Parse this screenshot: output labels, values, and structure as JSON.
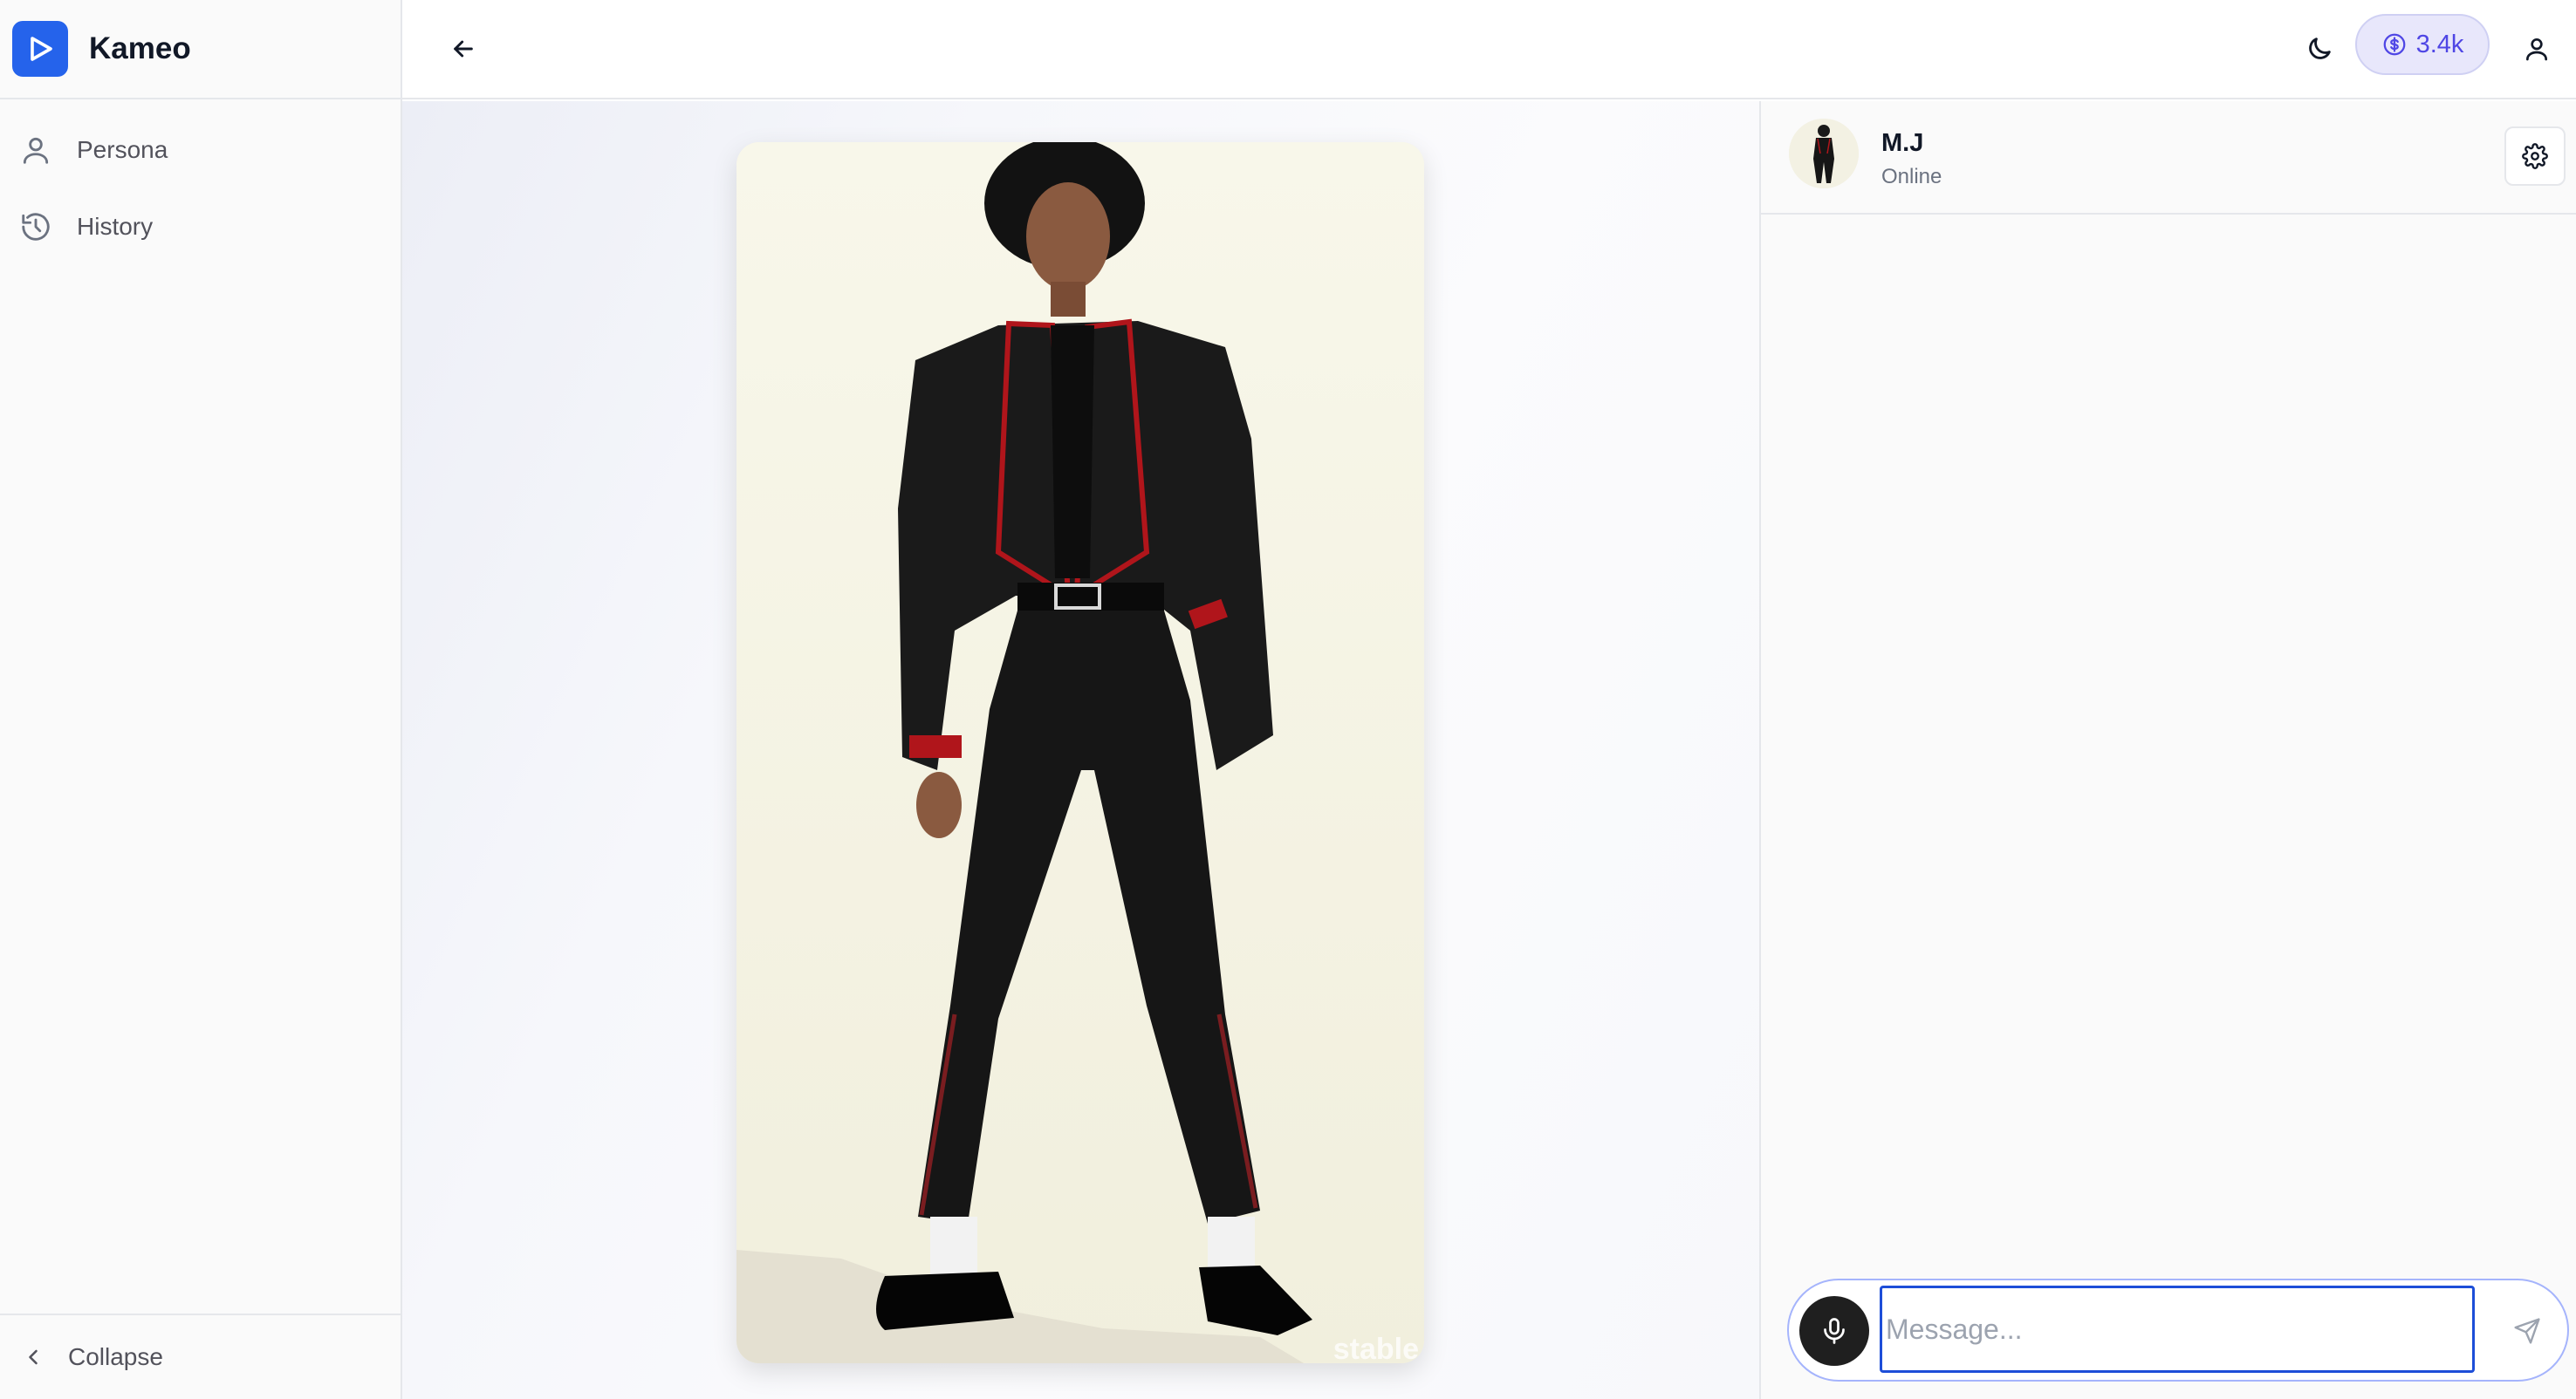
{
  "app": {
    "name": "Kameo"
  },
  "sidebar": {
    "items": [
      {
        "label": "Persona",
        "icon": "user-icon"
      },
      {
        "label": "History",
        "icon": "history-icon"
      }
    ],
    "collapse_label": "Collapse"
  },
  "header": {
    "credits": "3.4k",
    "accent": "#2563eb",
    "credits_color": "#4f46e5"
  },
  "image": {
    "watermark": "stable"
  },
  "chat": {
    "name": "M.J",
    "status": "Online",
    "input_placeholder": "Message...",
    "input_value": ""
  }
}
